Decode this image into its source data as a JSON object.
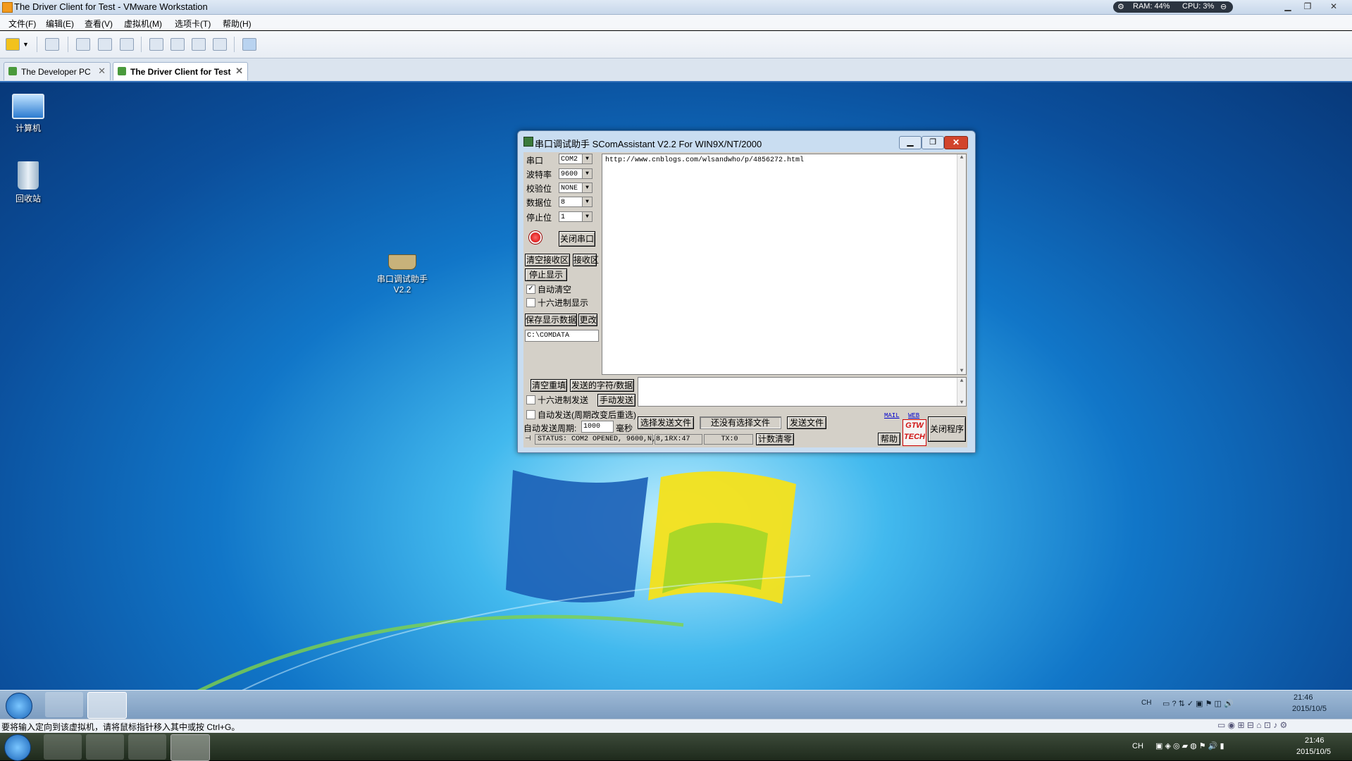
{
  "host": {
    "title": "The Driver Client for Test - VMware Workstation",
    "ram": "RAM: 44%",
    "cpu": "CPU: 3%",
    "menu": [
      "文件(F)",
      "编辑(E)",
      "查看(V)",
      "虚拟机(M)",
      "选项卡(T)",
      "帮助(H)"
    ],
    "tabs": [
      {
        "label": "The Developer PC"
      },
      {
        "label": "The Driver Client for Test"
      }
    ],
    "status_text": "要将输入定向到该虚拟机，请将鼠标指针移入其中或按 Ctrl+G。",
    "clock_time": "21:46",
    "clock_date": "2015/10/5",
    "lang": "CH"
  },
  "desktop": {
    "icons": [
      {
        "label": "计算机"
      },
      {
        "label": "回收站"
      },
      {
        "label": "串口调试助手 V2.2"
      }
    ],
    "clock_time": "21:46",
    "clock_date": "2015/10/5",
    "lang": "CH"
  },
  "scom": {
    "title": "串口调试助手 SComAssistant V2.2 For WIN9X/NT/2000",
    "settings": [
      {
        "label": "串口",
        "value": "COM2"
      },
      {
        "label": "波特率",
        "value": "9600"
      },
      {
        "label": "校验位",
        "value": "NONE"
      },
      {
        "label": "数据位",
        "value": "8"
      },
      {
        "label": "停止位",
        "value": "1"
      }
    ],
    "close_port": "关闭串口",
    "clear_receive": "清空接收区",
    "receive_area": "接收区",
    "stop_display": "停止显示",
    "auto_clear": "自动清空",
    "hex_display": "十六进制显示",
    "save_data": "保存显示数据",
    "change": "更改",
    "save_path": "C:\\COMDATA",
    "receive_text": "http://www.cnblogs.com/wlsandwho/p/4856272.html",
    "clear_refill": "清空重填",
    "send_chars": "发送的字符/数据",
    "hex_send": "十六进制发送",
    "manual_send": "手动发送",
    "auto_send": "自动发送(周期改变后重选)",
    "auto_period_label": "自动发送周期:",
    "auto_period_value": "1000",
    "ms": "毫秒",
    "choose_file": "选择发送文件",
    "no_file": "还没有选择文件",
    "send_file": "发送文件",
    "mail": "MAIL",
    "web": "WEB",
    "help": "帮助",
    "exit": "关闭程序",
    "logo": "GTW TECH",
    "status": "STATUS: COM2 OPENED, 9600,N,8,1",
    "rx": "RX:47",
    "tx": "TX:0",
    "reset_count": "计数清零"
  }
}
